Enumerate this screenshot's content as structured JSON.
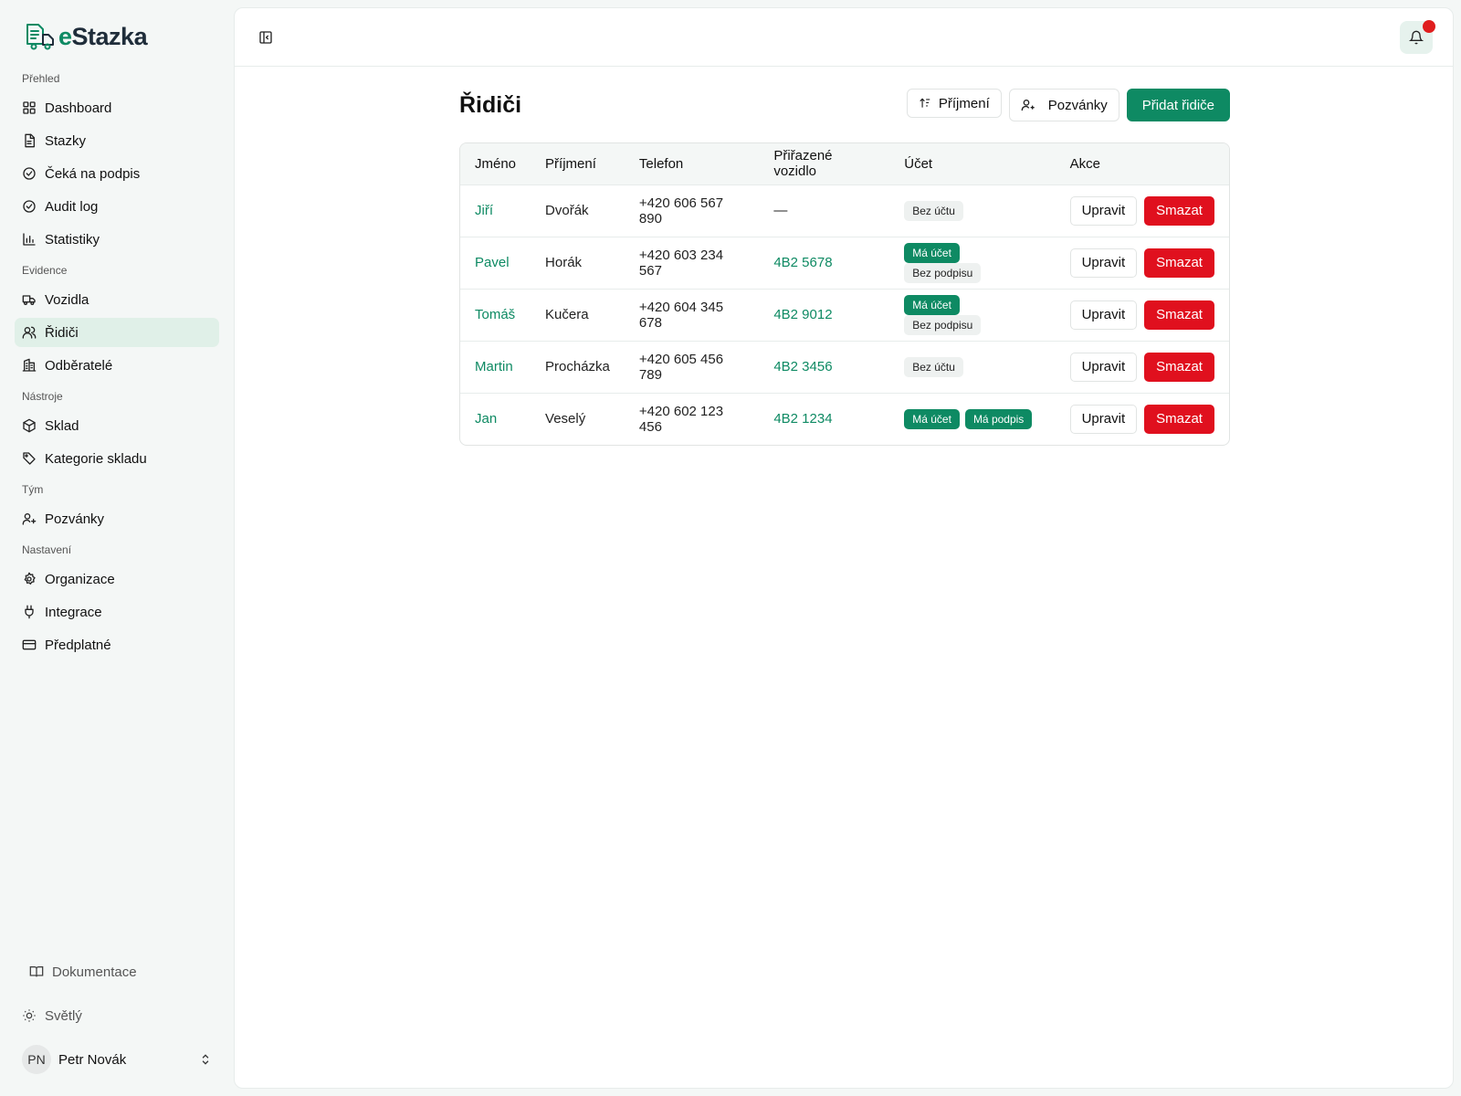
{
  "app": {
    "logo_prefix": "e",
    "logo_suffix": "Stazka"
  },
  "sidebar": {
    "groups": [
      {
        "label": "Přehled",
        "items": [
          {
            "label": "Dashboard",
            "icon": "grid-icon"
          },
          {
            "label": "Stazky",
            "icon": "document-icon"
          },
          {
            "label": "Čeká na podpis",
            "icon": "check-circle-icon"
          },
          {
            "label": "Audit log",
            "icon": "check-circle-icon"
          },
          {
            "label": "Statistiky",
            "icon": "bar-chart-icon"
          }
        ]
      },
      {
        "label": "Evidence",
        "items": [
          {
            "label": "Vozidla",
            "icon": "truck-icon"
          },
          {
            "label": "Řidiči",
            "icon": "users-icon",
            "active": true
          },
          {
            "label": "Odběratelé",
            "icon": "building-icon"
          }
        ]
      },
      {
        "label": "Nástroje",
        "items": [
          {
            "label": "Sklad",
            "icon": "box-icon"
          },
          {
            "label": "Kategorie skladu",
            "icon": "tag-icon"
          }
        ]
      },
      {
        "label": "Tým",
        "items": [
          {
            "label": "Pozvánky",
            "icon": "user-plus-icon"
          }
        ]
      },
      {
        "label": "Nastavení",
        "items": [
          {
            "label": "Organizace",
            "icon": "gear-icon"
          },
          {
            "label": "Integrace",
            "icon": "plug-icon"
          },
          {
            "label": "Předplatné",
            "icon": "credit-card-icon"
          }
        ]
      }
    ],
    "docs_label": "Dokumentace",
    "theme_label": "Světlý",
    "user": {
      "initials": "PN",
      "name": "Petr Novák"
    }
  },
  "page": {
    "title": "Řidiči",
    "sort_label": "Příjmení",
    "invites_label": "Pozvánky",
    "add_label": "Přidat řidiče"
  },
  "table": {
    "columns": [
      "Jméno",
      "Příjmení",
      "Telefon",
      "Přiřazené vozidlo",
      "Účet",
      "Akce"
    ],
    "rows": [
      {
        "first": "Jiří",
        "last": "Dvořák",
        "phone": "+420 606 567 890",
        "vehicle": "—",
        "badges": [
          {
            "text": "Bez účtu",
            "kind": "grey"
          }
        ]
      },
      {
        "first": "Pavel",
        "last": "Horák",
        "phone": "+420 603 234 567",
        "vehicle": "4B2 5678",
        "badges": [
          {
            "text": "Má účet",
            "kind": "green"
          },
          {
            "text": "Bez podpisu",
            "kind": "grey"
          }
        ]
      },
      {
        "first": "Tomáš",
        "last": "Kučera",
        "phone": "+420 604 345 678",
        "vehicle": "4B2 9012",
        "badges": [
          {
            "text": "Má účet",
            "kind": "green"
          },
          {
            "text": "Bez podpisu",
            "kind": "grey"
          }
        ]
      },
      {
        "first": "Martin",
        "last": "Procházka",
        "phone": "+420 605 456 789",
        "vehicle": "4B2 3456",
        "badges": [
          {
            "text": "Bez účtu",
            "kind": "grey"
          }
        ]
      },
      {
        "first": "Jan",
        "last": "Veselý",
        "phone": "+420 602 123 456",
        "vehicle": "4B2 1234",
        "badges": [
          {
            "text": "Má účet",
            "kind": "green"
          },
          {
            "text": "Má podpis",
            "kind": "green"
          }
        ]
      }
    ],
    "edit_label": "Upravit",
    "delete_label": "Smazat"
  },
  "colors": {
    "accent": "#0e8a63",
    "danger": "#e0101e",
    "active_bg": "#e0f0e8"
  }
}
